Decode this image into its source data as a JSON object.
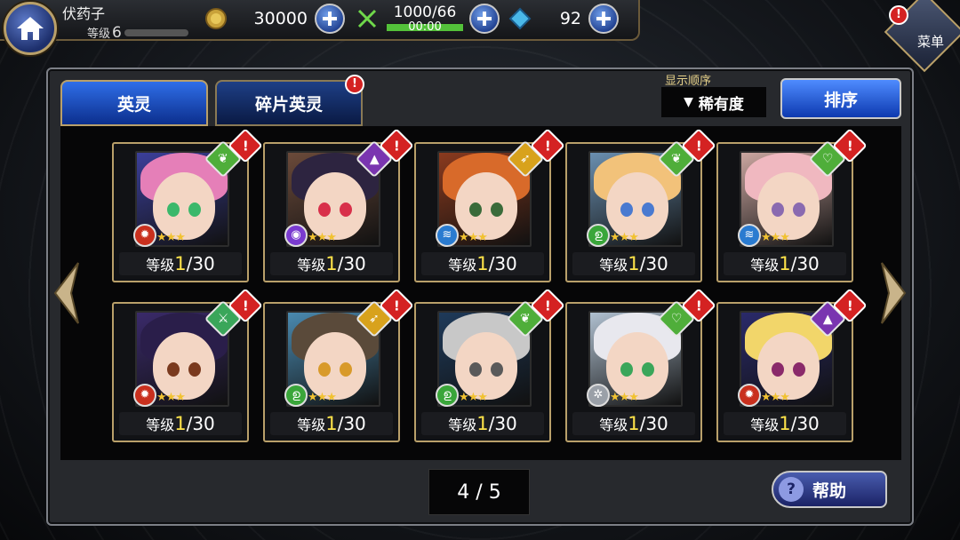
{
  "player": {
    "name": "伏药子",
    "level_label": "等级",
    "level": "6"
  },
  "resources": {
    "gold": "30000",
    "stamina": "1000/66",
    "stamina_timer": "00:00",
    "gems": "92"
  },
  "menu": {
    "label": "菜单",
    "badge": "!"
  },
  "tabs": [
    {
      "label": "英灵",
      "active": true
    },
    {
      "label": "碎片英灵",
      "active": false,
      "badge": "!"
    }
  ],
  "sort": {
    "caption": "显示顺序",
    "current": "稀有度",
    "button": "排序"
  },
  "cards": [
    {
      "level_label": "等级",
      "level": "1",
      "max": "/30",
      "hair": "#e57fb8",
      "eye": "#3bb86b",
      "bg": "#3b3f9a",
      "cls_color": "#4fae3a",
      "cls_icon": "leaf-icon",
      "cls_glyph": "❦",
      "attr_color": "#c9301e",
      "attr_glyph": "✹",
      "stars": "★★★"
    },
    {
      "level_label": "等级",
      "level": "1",
      "max": "/30",
      "hair": "#2d2440",
      "eye": "#d8304a",
      "bg": "#6b4a3a",
      "cls_color": "#7a35b0",
      "cls_icon": "wizard-hat-icon",
      "cls_glyph": "▲",
      "attr_color": "#7a3bd0",
      "attr_glyph": "◉",
      "stars": "★★★"
    },
    {
      "level_label": "等级",
      "level": "1",
      "max": "/30",
      "hair": "#d86a2a",
      "eye": "#3a6b3a",
      "bg": "#8a3a1e",
      "cls_color": "#d8a21c",
      "cls_icon": "bow-icon",
      "cls_glyph": "➶",
      "attr_color": "#2a7bd0",
      "attr_glyph": "≋",
      "stars": "★★★"
    },
    {
      "level_label": "等级",
      "level": "1",
      "max": "/30",
      "hair": "#f2c27a",
      "eye": "#4a7ad0",
      "bg": "#6a8fb0",
      "cls_color": "#4fae3a",
      "cls_icon": "leaf-icon",
      "cls_glyph": "❦",
      "attr_color": "#3aa63a",
      "attr_glyph": "ഉ",
      "stars": "★★★"
    },
    {
      "level_label": "等级",
      "level": "1",
      "max": "/30",
      "hair": "#f0b8c0",
      "eye": "#8a6ab0",
      "bg": "#caa6a0",
      "cls_color": "#4fae3a",
      "cls_icon": "heart-icon",
      "cls_glyph": "♡",
      "attr_color": "#2a7bd0",
      "attr_glyph": "≋",
      "stars": "★★★"
    },
    {
      "level_label": "等级",
      "level": "1",
      "max": "/30",
      "hair": "#2a1e4a",
      "eye": "#7a3a1e",
      "bg": "#3a2a6a",
      "cls_color": "#3aa65a",
      "cls_icon": "sword-icon",
      "cls_glyph": "⚔",
      "attr_color": "#c9301e",
      "attr_glyph": "✹",
      "stars": "★★★"
    },
    {
      "level_label": "等级",
      "level": "1",
      "max": "/30",
      "hair": "#5a4a3a",
      "eye": "#d89a2a",
      "bg": "#4a8ab0",
      "cls_color": "#d8a21c",
      "cls_icon": "bow-icon",
      "cls_glyph": "➶",
      "attr_color": "#3aa63a",
      "attr_glyph": "ഉ",
      "stars": "★★★"
    },
    {
      "level_label": "等级",
      "level": "1",
      "max": "/30",
      "hair": "#c8c8c8",
      "eye": "#5a5a5a",
      "bg": "#1e3a5a",
      "cls_color": "#4fae3a",
      "cls_icon": "leaf-icon",
      "cls_glyph": "❦",
      "attr_color": "#3aa63a",
      "attr_glyph": "ഉ",
      "stars": "★★★"
    },
    {
      "level_label": "等级",
      "level": "1",
      "max": "/30",
      "hair": "#e8e8ee",
      "eye": "#3aa65a",
      "bg": "#b0c0d0",
      "cls_color": "#4fae3a",
      "cls_icon": "heart-icon",
      "cls_glyph": "♡",
      "attr_color": "#9aa0a8",
      "attr_glyph": "✲",
      "stars": "★★★"
    },
    {
      "level_label": "等级",
      "level": "1",
      "max": "/30",
      "hair": "#f2d66a",
      "eye": "#8a2a6a",
      "bg": "#2a2a6a",
      "cls_color": "#7a35b0",
      "cls_icon": "wizard-hat-icon",
      "cls_glyph": "▲",
      "attr_color": "#c9301e",
      "attr_glyph": "✹",
      "stars": "★★★"
    }
  ],
  "pager": {
    "text": "4 / 5"
  },
  "help": {
    "label": "帮助",
    "icon": "?"
  }
}
